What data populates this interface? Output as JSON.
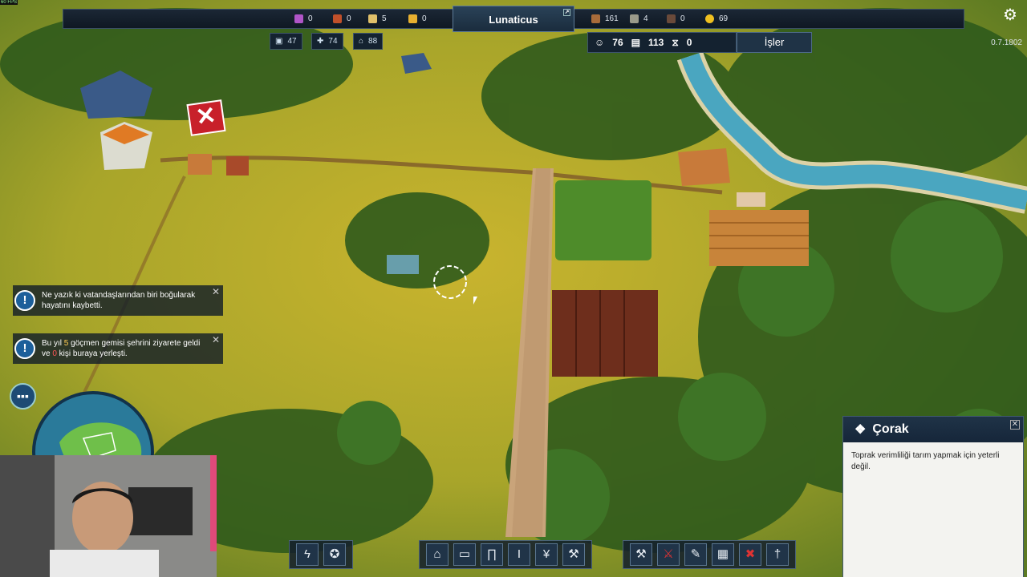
{
  "fps_label": "60 FPS",
  "colors": {
    "bar_bg": "#142230",
    "accent": "#1d5f9a",
    "danger": "#c8202a"
  },
  "topbar": {
    "left_resources": [
      {
        "icon": "berry-icon",
        "value": "0",
        "color": "#b055c8"
      },
      {
        "icon": "meat-icon",
        "value": "0",
        "color": "#c0502a"
      },
      {
        "icon": "bread-icon",
        "value": "5",
        "color": "#e0c06a"
      },
      {
        "icon": "cheese-icon",
        "value": "0",
        "color": "#e8b030"
      }
    ],
    "city_name": "Lunaticus",
    "right_resources": [
      {
        "icon": "wood-icon",
        "value": "161",
        "color": "#a86b3a"
      },
      {
        "icon": "stone-icon",
        "value": "4",
        "color": "#9a9a8a"
      },
      {
        "icon": "iron-icon",
        "value": "0",
        "color": "#6a4a3a"
      },
      {
        "icon": "gold-icon",
        "value": "69",
        "color": "#f0c020"
      }
    ]
  },
  "stats": [
    {
      "icon": "education-icon",
      "value": "47"
    },
    {
      "icon": "health-icon",
      "value": "74"
    },
    {
      "icon": "culture-icon",
      "value": "88"
    }
  ],
  "population": {
    "citizens": "76",
    "homes": "113",
    "unemployed": "0"
  },
  "jobs_label": "İşler",
  "version": "0.7.1802",
  "notifications": [
    {
      "text": "Ne yazık ki vatandaşlarından biri boğularak hayatını kaybetti."
    },
    {
      "pre": "Bu yıl ",
      "count": "5",
      "post": " göçmen gemisi şehrini ziyarete geldi ve ",
      "count2": "0",
      "post2": " kişi buraya yerleşti."
    }
  ],
  "info_panel": {
    "title": "Çorak",
    "body": "Toprak verimliliği tarım yapmak için yeterli değil."
  },
  "toolbar_left": [
    {
      "icon": "lightning-icon"
    },
    {
      "icon": "star-emblem-icon"
    }
  ],
  "toolbar_mid": [
    {
      "icon": "town-hall-icon"
    },
    {
      "icon": "wall-icon"
    },
    {
      "icon": "temple-icon"
    },
    {
      "icon": "pillar-icon"
    },
    {
      "icon": "wheat-icon"
    },
    {
      "icon": "hammer-icon"
    }
  ],
  "toolbar_right": [
    {
      "icon": "crossed-tools-icon"
    },
    {
      "icon": "demolish-tools-icon"
    },
    {
      "icon": "brush-icon"
    },
    {
      "icon": "grid-icon"
    },
    {
      "icon": "cancel-icon"
    },
    {
      "icon": "sword-icon"
    }
  ]
}
